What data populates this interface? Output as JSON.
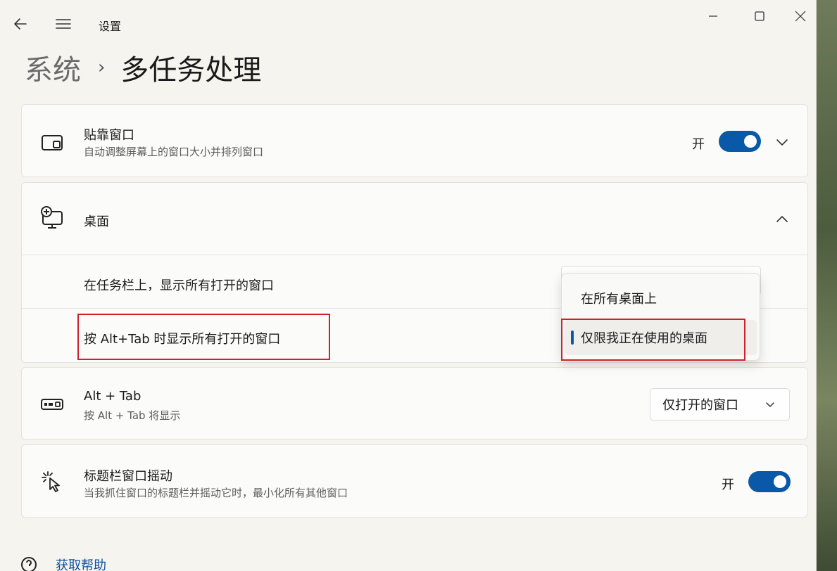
{
  "window": {
    "title": "设置"
  },
  "header": {
    "parent": "系统",
    "separator": "›",
    "current": "多任务处理"
  },
  "snap": {
    "title": "贴靠窗口",
    "subtitle": "自动调整屏幕上的窗口大小并排列窗口",
    "toggle_label": "开",
    "toggle_on": true,
    "icon": "snap-window-icon"
  },
  "desktops": {
    "title": "桌面",
    "icon": "virtual-desktop-icon",
    "expanded": true,
    "rows": [
      {
        "label": "在任务栏上，显示所有打开的窗口"
      },
      {
        "label": "按 Alt+Tab 时显示所有打开的窗口"
      }
    ],
    "popup_options": [
      {
        "label": "在所有桌面上"
      },
      {
        "label": "仅限我正在使用的桌面",
        "selected": true
      }
    ]
  },
  "alttab": {
    "title": "Alt + Tab",
    "subtitle": "按 Alt + Tab 将显示",
    "select_value": "仅打开的窗口",
    "icon": "keyboard-icon"
  },
  "shake": {
    "title": "标题栏窗口摇动",
    "subtitle": "当我抓住窗口的标题栏并摇动它时，最小化所有其他窗口",
    "toggle_label": "开",
    "toggle_on": true,
    "icon": "shake-cursor-icon"
  },
  "help": {
    "label": "获取帮助",
    "icon": "help-icon"
  },
  "colors": {
    "accent": "#0a59a8",
    "highlight": "#d0202a"
  }
}
